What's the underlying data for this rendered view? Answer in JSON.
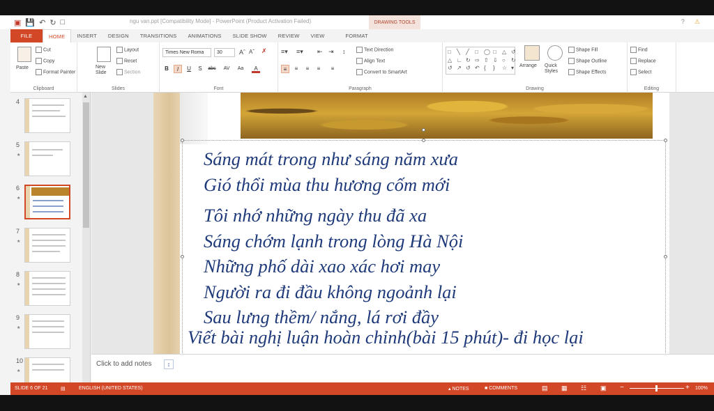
{
  "titlebar": {
    "doc_title": "ngu van.ppt [Compatibility Mode] - PowerPoint (Product Activation Failed)",
    "contextual_tab_group": "DRAWING TOOLS",
    "help": "?"
  },
  "tabs": [
    "FILE",
    "HOME",
    "INSERT",
    "DESIGN",
    "TRANSITIONS",
    "ANIMATIONS",
    "SLIDE SHOW",
    "REVIEW",
    "VIEW",
    "FORMAT"
  ],
  "ribbon": {
    "clipboard": {
      "paste": "Paste",
      "cut": "Cut",
      "copy": "Copy",
      "format_painter": "Format Painter",
      "label": "Clipboard"
    },
    "slides": {
      "new_slide": "New Slide",
      "layout": "Layout",
      "reset": "Reset",
      "section": "Section",
      "label": "Slides"
    },
    "font": {
      "font_name": "Times New Roma",
      "font_size": "30",
      "label": "Font",
      "bold": "B",
      "italic": "I",
      "underline": "U",
      "shadow": "S",
      "strike": "abc",
      "spacing": "AV",
      "case": "Aa",
      "color": "A"
    },
    "paragraph": {
      "text_direction": "Text Direction",
      "align_text": "Align Text",
      "convert": "Convert to SmartArt",
      "label": "Paragraph"
    },
    "drawing": {
      "arrange": "Arrange",
      "quick_styles": "Quick Styles",
      "shape_fill": "Shape Fill",
      "shape_outline": "Shape Outline",
      "shape_effects": "Shape Effects",
      "label": "Drawing"
    },
    "editing": {
      "find": "Find",
      "replace": "Replace",
      "select": "Select",
      "label": "Editing"
    }
  },
  "thumbnails": [
    {
      "num": "4"
    },
    {
      "num": "5"
    },
    {
      "num": "6"
    },
    {
      "num": "7"
    },
    {
      "num": "8"
    },
    {
      "num": "9"
    },
    {
      "num": "10"
    }
  ],
  "slide": {
    "poem_lines": [
      "Sáng mát trong như sáng năm xưa",
      "Gió thổi mùa thu hương cốm mới",
      "Tôi nhớ những ngày thu đã xa",
      "Sáng chớm lạnh trong lòng Hà Nội",
      "Những phố dài xao xác hơi may",
      "Người ra đi đầu không ngoảnh lại",
      "Sau lưng thềm/ nắng, lá rơi đầy"
    ],
    "instruction": "Viết bài nghị luận hoàn chỉnh(bài 15 phút)- đi học lại"
  },
  "notes": {
    "placeholder": "Click to add notes"
  },
  "statusbar": {
    "slide_info": "SLIDE 6 OF 21",
    "language": "ENGLISH (UNITED STATES)",
    "notes": "NOTES",
    "comments": "COMMENTS",
    "zoom": "100%"
  },
  "colors": {
    "accent": "#d24726",
    "poem_text": "#1f3a7a"
  }
}
